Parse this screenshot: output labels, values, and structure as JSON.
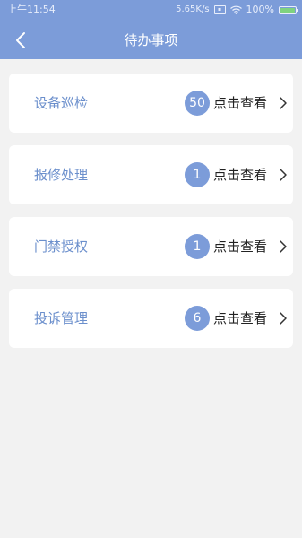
{
  "status_bar": {
    "time": "上午11:54",
    "net_speed": "5.65K/s",
    "battery": "100%",
    "icons": [
      "sim-icon",
      "wifi-icon",
      "battery-icon"
    ]
  },
  "header": {
    "title": "待办事项",
    "back_icon": "chevron-left-icon",
    "background": "#7c9cd9"
  },
  "items": [
    {
      "label": "设备巡检",
      "count": "50",
      "action": "点击查看"
    },
    {
      "label": "报修处理",
      "count": "1",
      "action": "点击查看"
    },
    {
      "label": "门禁授权",
      "count": "1",
      "action": "点击查看"
    },
    {
      "label": "投诉管理",
      "count": "6",
      "action": "点击查看"
    }
  ],
  "colors": {
    "accent": "#7c9cd9",
    "label": "#6b8fcc",
    "background": "#f2f2f2"
  }
}
